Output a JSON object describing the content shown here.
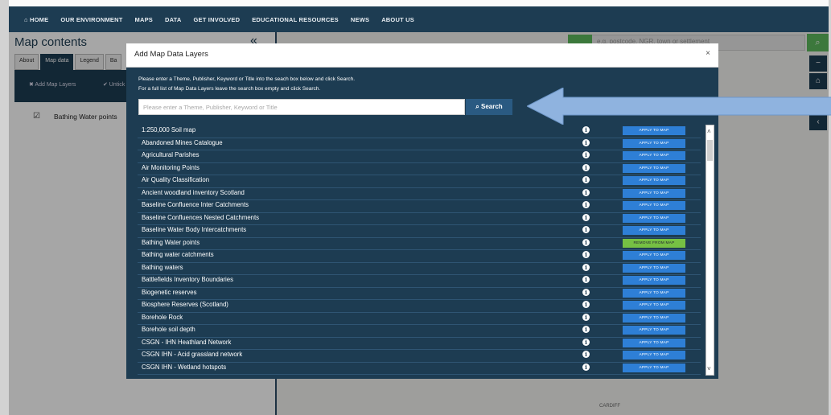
{
  "topnav": [
    "⌂ HOME",
    "OUR ENVIRONMENT",
    "MAPS",
    "DATA",
    "GET INVOLVED",
    "EDUCATIONAL RESOURCES",
    "NEWS",
    "ABOUT US"
  ],
  "left_panel": {
    "title": "Map contents",
    "collapse": "«",
    "tabs": [
      "About",
      "Map data",
      "Legend",
      "Ba"
    ],
    "actions": [
      "✖ Add Map Layers",
      "✔ Untick a"
    ],
    "layer_row": "Bathing Water points",
    "check": "☑"
  },
  "map": {
    "search_placeholder": "e.g. postcode, NGR, town or settlement",
    "go_icon": "⌕",
    "side_buttons": [
      "−",
      "⌂",
      "‹"
    ],
    "place_label": "CARDIFF"
  },
  "modal": {
    "title": "Add Map Data Layers",
    "close": "×",
    "instruction_1": "Please enter a Theme, Publisher, Keyword or Title into the seach box below and click Search.",
    "instruction_2": "For a full list of Map Data Layers leave the search box empty and click Search.",
    "search_placeholder": "Please enter a Theme, Publisher, Keyword or Title",
    "search_button": "⌕ Search",
    "info_glyph": "i",
    "apply_label": "APPLY TO MAP",
    "remove_label": "REMOVE FROM MAP",
    "scroll_up": "˄",
    "scroll_down": "˅",
    "layers": [
      {
        "name": "1:250,000 Soil map",
        "added": false
      },
      {
        "name": "Abandoned Mines Catalogue",
        "added": false
      },
      {
        "name": "Agricultural Parishes",
        "added": false
      },
      {
        "name": "Air Monitoring Points",
        "added": false
      },
      {
        "name": "Air Quality Classification",
        "added": false
      },
      {
        "name": "Ancient woodland inventory Scotland",
        "added": false
      },
      {
        "name": "Baseline Confluence Inter Catchments",
        "added": false
      },
      {
        "name": "Baseline Confluences Nested Catchments",
        "added": false
      },
      {
        "name": "Baseline Water Body Intercatchments",
        "added": false
      },
      {
        "name": "Bathing Water points",
        "added": true
      },
      {
        "name": "Bathing water catchments",
        "added": false
      },
      {
        "name": "Bathing waters",
        "added": false
      },
      {
        "name": "Battlefields Inventory Boundaries",
        "added": false
      },
      {
        "name": "Biogenetic reserves",
        "added": false
      },
      {
        "name": "Biosphere Reserves (Scotland)",
        "added": false
      },
      {
        "name": "Borehole Rock",
        "added": false
      },
      {
        "name": "Borehole soil depth",
        "added": false
      },
      {
        "name": "CSGN - IHN Heathland Network",
        "added": false
      },
      {
        "name": "CSGN IHN - Acid grassland network",
        "added": false
      },
      {
        "name": "CSGN IHN - Wetland hotspots",
        "added": false
      }
    ]
  }
}
